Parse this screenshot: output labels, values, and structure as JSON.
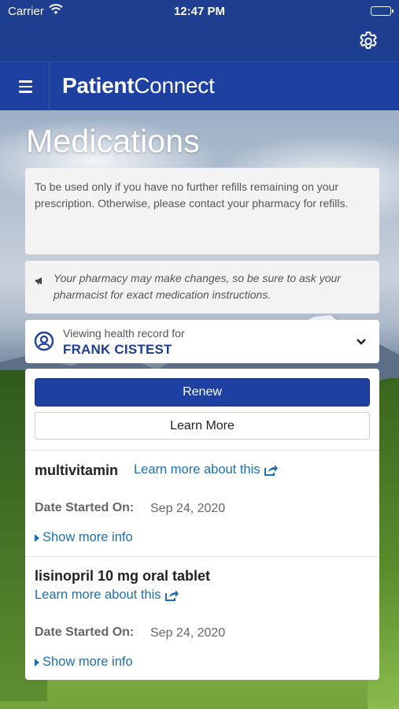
{
  "status_bar": {
    "carrier": "Carrier",
    "time": "12:47 PM"
  },
  "app": {
    "brand_bold": "Patient",
    "brand_light": "Connect"
  },
  "page": {
    "title": "Medications"
  },
  "notice": {
    "text": "To be used only if you have no further refills remaining on your prescription. Otherwise, please contact your pharmacy for refills."
  },
  "warning": {
    "text": "Your pharmacy may make changes, so be sure to ask your pharmacist for exact medication instructions."
  },
  "health_record": {
    "label": "Viewing health record for",
    "name": "FRANK CISTEST"
  },
  "actions": {
    "renew_label": "Renew",
    "learn_more_label": "Learn More"
  },
  "medications": [
    {
      "name": "multivitamin",
      "link_label": "Learn more about this",
      "date_label": "Date Started On:",
      "date_value": "Sep 24, 2020",
      "more_label": "Show more info"
    },
    {
      "name": "lisinopril 10 mg oral tablet",
      "link_label": "Learn more about this",
      "date_label": "Date Started On:",
      "date_value": "Sep 24, 2020",
      "more_label": "Show more info"
    }
  ],
  "colors": {
    "primary": "#1e40a0",
    "link": "#1f6fae",
    "header": "#1e3f8f"
  },
  "icons": {
    "settings": "gear-icon",
    "menu": "hamburger-icon",
    "warning": "megaphone-icon",
    "person": "person-circle-icon",
    "expand": "chevron-down-icon",
    "external": "share-external-icon"
  }
}
